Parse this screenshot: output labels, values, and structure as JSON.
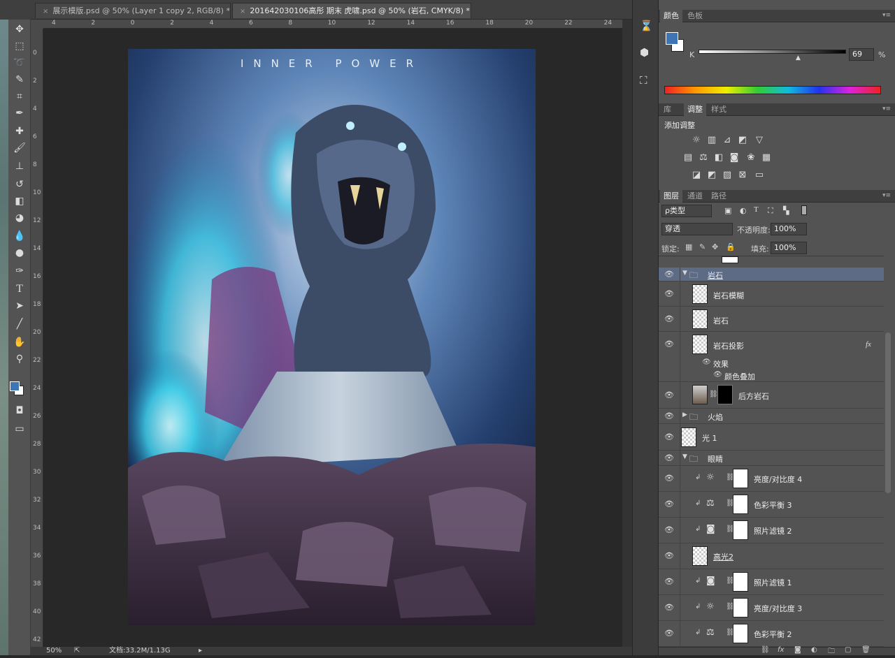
{
  "tabs": [
    {
      "label": "展示模版.psd @ 50% (Layer 1 copy 2, RGB/8) *",
      "close": "×",
      "active": false
    },
    {
      "label": "201642030106高彤 期末 虎啸.psd @ 50% (岩石, CMYK/8) *",
      "close": "×",
      "active": true
    }
  ],
  "ruler": {
    "h": [
      "4",
      "2",
      "0",
      "2",
      "4",
      "6",
      "8",
      "10",
      "12",
      "14",
      "16",
      "18",
      "20",
      "22",
      "24"
    ],
    "v": [
      "0",
      "2",
      "4",
      "6",
      "8",
      "10",
      "12",
      "14",
      "16",
      "18",
      "20",
      "22",
      "24",
      "26",
      "28",
      "30",
      "32",
      "34",
      "36",
      "38",
      "40",
      "42"
    ]
  },
  "artwork": {
    "title": "INNER POWER"
  },
  "status": {
    "zoom": "50%",
    "doc": "文档:33.2M/1.13G"
  },
  "color_panel": {
    "tabs": [
      "颜色",
      "色板"
    ],
    "channel": "K",
    "value": "69",
    "unit": "%",
    "fg": "#3f74b5",
    "bg": "#ffffff"
  },
  "adjust_panel": {
    "tabs": [
      "库",
      "调整",
      "样式"
    ],
    "title": "添加调整"
  },
  "layers_panel": {
    "tabs": [
      "图层",
      "通道",
      "路径"
    ],
    "filter": "ρ类型",
    "blend": "穿透",
    "opacity_label": "不透明度:",
    "opacity": "100%",
    "lock_label": "锁定:",
    "fill_label": "填充:",
    "fill": "100%",
    "layers": [
      {
        "name": "岩石",
        "type": "group-open"
      },
      {
        "name": "岩石模糊",
        "type": "layer"
      },
      {
        "name": "岩石",
        "type": "layer"
      },
      {
        "name": "岩石投影",
        "type": "layer",
        "fx": "fx"
      },
      {
        "name": "效果",
        "type": "effects"
      },
      {
        "name": "颜色叠加",
        "type": "effect"
      },
      {
        "name": "后方岩石",
        "type": "masked"
      },
      {
        "name": "火焰",
        "type": "group-closed"
      },
      {
        "name": "光 1",
        "type": "layer"
      },
      {
        "name": "眼睛",
        "type": "group-open"
      },
      {
        "name": "亮度/对比度 4",
        "type": "adjust",
        "icon": "☼"
      },
      {
        "name": "色彩平衡 3",
        "type": "adjust",
        "icon": "⚖"
      },
      {
        "name": "照片滤镜 2",
        "type": "adjust",
        "icon": "◙"
      },
      {
        "name": "高光2",
        "type": "layer"
      },
      {
        "name": "照片滤镜 1",
        "type": "adjust",
        "icon": "◙"
      },
      {
        "name": "亮度/对比度 3",
        "type": "adjust",
        "icon": "☼"
      },
      {
        "name": "色彩平衡 2",
        "type": "adjust",
        "icon": "⚖"
      }
    ]
  }
}
